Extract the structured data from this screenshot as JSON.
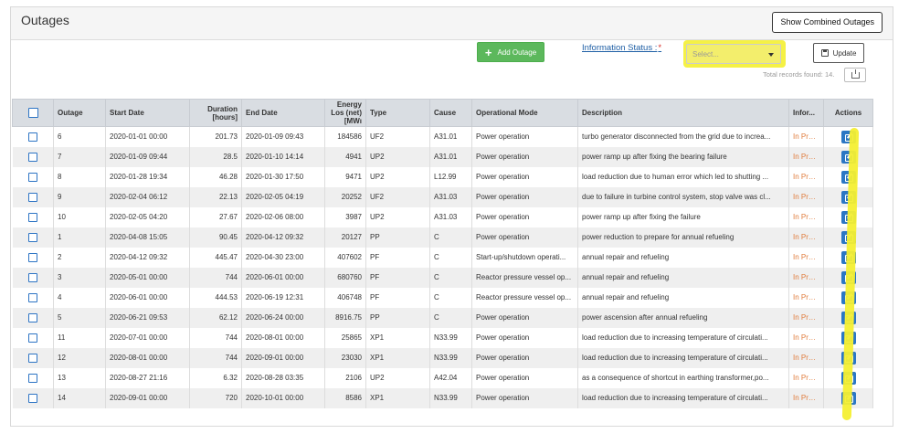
{
  "panel": {
    "title": "Outages",
    "combined_label": "Show Combined Outages"
  },
  "toolbar": {
    "add_label": "Add Outage",
    "info_status_label": "Information Status :",
    "required_mark": "*",
    "select_placeholder": "Select...",
    "update_label": "Update",
    "total_records": "Total records found: 14."
  },
  "table": {
    "headers": {
      "outage": "Outage",
      "start": "Start Date",
      "duration": "Duration [hours]",
      "end": "End Date",
      "energy": "Energy Los (net)[MWı",
      "type": "Type",
      "cause": "Cause",
      "mode": "Operational Mode",
      "description": "Description",
      "info": "Infor...",
      "actions": "Actions"
    },
    "rows": [
      {
        "outage": "6",
        "start": "2020-01-01 00:00",
        "duration": "201.73",
        "end": "2020-01-09 09:43",
        "energy": "184586",
        "type": "UF2",
        "cause": "A31.01",
        "mode": "Power operation",
        "description": "turbo generator disconnected from the grid due to increa...",
        "info": "In Progres"
      },
      {
        "outage": "7",
        "start": "2020-01-09 09:44",
        "duration": "28.5",
        "end": "2020-01-10 14:14",
        "energy": "4941",
        "type": "UP2",
        "cause": "A31.01",
        "mode": "Power operation",
        "description": "power ramp up after fixing the bearing failure",
        "info": "In Progres"
      },
      {
        "outage": "8",
        "start": "2020-01-28 19:34",
        "duration": "46.28",
        "end": "2020-01-30 17:50",
        "energy": "9471",
        "type": "UP2",
        "cause": "L12.99",
        "mode": "Power operation",
        "description": "load reduction due to human error which led to shutting ...",
        "info": "In Progres"
      },
      {
        "outage": "9",
        "start": "2020-02-04 06:12",
        "duration": "22.13",
        "end": "2020-02-05 04:19",
        "energy": "20252",
        "type": "UF2",
        "cause": "A31.03",
        "mode": "Power operation",
        "description": "due to failure in turbine control system, stop valve was cl...",
        "info": "In Progres"
      },
      {
        "outage": "10",
        "start": "2020-02-05 04:20",
        "duration": "27.67",
        "end": "2020-02-06 08:00",
        "energy": "3987",
        "type": "UP2",
        "cause": "A31.03",
        "mode": "Power operation",
        "description": "power ramp up after fixing the failure",
        "info": "In Progres"
      },
      {
        "outage": "1",
        "start": "2020-04-08 15:05",
        "duration": "90.45",
        "end": "2020-04-12 09:32",
        "energy": "20127",
        "type": "PP",
        "cause": "C",
        "mode": "Power operation",
        "description": "power reduction to prepare for annual refueling",
        "info": "In Progres"
      },
      {
        "outage": "2",
        "start": "2020-04-12 09:32",
        "duration": "445.47",
        "end": "2020-04-30 23:00",
        "energy": "407602",
        "type": "PF",
        "cause": "C",
        "mode": "Start-up/shutdown operati...",
        "description": "annual repair and refueling",
        "info": "In Progres"
      },
      {
        "outage": "3",
        "start": "2020-05-01 00:00",
        "duration": "744",
        "end": "2020-06-01 00:00",
        "energy": "680760",
        "type": "PF",
        "cause": "C",
        "mode": "Reactor pressure vessel op...",
        "description": "annual repair and refueling",
        "info": "In Progres"
      },
      {
        "outage": "4",
        "start": "2020-06-01 00:00",
        "duration": "444.53",
        "end": "2020-06-19 12:31",
        "energy": "406748",
        "type": "PF",
        "cause": "C",
        "mode": "Reactor pressure vessel op...",
        "description": "annual repair and refueling",
        "info": "In Progres"
      },
      {
        "outage": "5",
        "start": "2020-06-21 09:53",
        "duration": "62.12",
        "end": "2020-06-24 00:00",
        "energy": "8916.75",
        "type": "PP",
        "cause": "C",
        "mode": "Power operation",
        "description": "power ascension after annual refueling",
        "info": "In Progres"
      },
      {
        "outage": "11",
        "start": "2020-07-01 00:00",
        "duration": "744",
        "end": "2020-08-01 00:00",
        "energy": "25865",
        "type": "XP1",
        "cause": "N33.99",
        "mode": "Power operation",
        "description": "load reduction due to increasing temperature of circulati...",
        "info": "In Progres"
      },
      {
        "outage": "12",
        "start": "2020-08-01 00:00",
        "duration": "744",
        "end": "2020-09-01 00:00",
        "energy": "23030",
        "type": "XP1",
        "cause": "N33.99",
        "mode": "Power operation",
        "description": "load reduction due to increasing temperature of circulati...",
        "info": "In Progres"
      },
      {
        "outage": "13",
        "start": "2020-08-27 21:16",
        "duration": "6.32",
        "end": "2020-08-28 03:35",
        "energy": "2106",
        "type": "UP2",
        "cause": "A42.04",
        "mode": "Power operation",
        "description": "as a consequence of shortcut in earthing transformer,po...",
        "info": "In Progres"
      },
      {
        "outage": "14",
        "start": "2020-09-01 00:00",
        "duration": "720",
        "end": "2020-10-01 00:00",
        "energy": "8586",
        "type": "XP1",
        "cause": "N33.99",
        "mode": "Power operation",
        "description": "load reduction due to increasing temperature of circulati...",
        "info": "In Progres"
      }
    ]
  },
  "colors": {
    "accent": "#2b77c4",
    "add_button": "#5cb85c",
    "status": "#e07b3a",
    "highlight": "#f4ef31"
  },
  "icons": {
    "add": "plus-icon",
    "update": "save-icon",
    "export": "export-icon",
    "edit": "edit-icon"
  }
}
